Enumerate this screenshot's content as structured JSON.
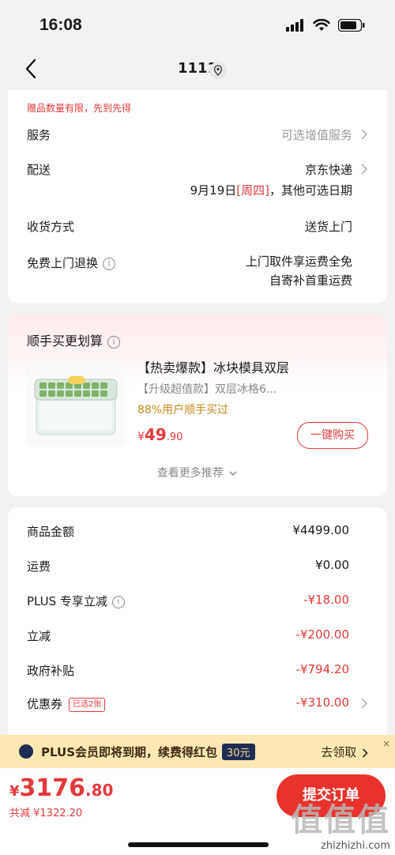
{
  "status": {
    "time": "16:08"
  },
  "nav": {
    "title": "1111"
  },
  "card1": {
    "gift_note": "赠品数量有限，先到先得",
    "service_label": "服务",
    "service_value": "可选增值服务",
    "delivery_label": "配送",
    "delivery_value": "京东快递",
    "delivery_date_prefix": "9月19日",
    "delivery_date_weekday": "[周四]",
    "delivery_date_suffix": "，其他可选日期",
    "receive_label": "收货方式",
    "receive_value": "送货上门",
    "return_label": "免费上门退换",
    "return_line1": "上门取件享运费全免",
    "return_line2": "自寄补首重运费"
  },
  "recommend": {
    "title": "顺手买更划算",
    "product_title": "【热卖爆款】冰块模具双层",
    "product_sub": "【升级超值款】双层冰格6...",
    "product_note": "88%用户顺手买过",
    "price_symbol": "¥",
    "price_int": "49",
    "price_dec": ".90",
    "buy_label": "一键购买",
    "more_label": "查看更多推荐"
  },
  "amounts": {
    "rows": [
      {
        "label": "商品金额",
        "value": "¥4499.00"
      },
      {
        "label": "运费",
        "value": "¥0.00"
      },
      {
        "label": "PLUS 专享立减",
        "value": "-¥18.00"
      },
      {
        "label": "立减",
        "value": "-¥200.00"
      },
      {
        "label": "政府补贴",
        "value": "-¥794.20"
      },
      {
        "label": "优惠券",
        "value": "-¥310.00"
      }
    ],
    "coupon_badge": "已选2张"
  },
  "plus": {
    "text": "PLUS会员即将到期，续费得红包",
    "amount": "30元",
    "action": "去领取",
    "close": "×"
  },
  "bottom": {
    "symbol": "¥",
    "total_int": "3176",
    "total_dec": ".80",
    "saved": "共减 ¥1322.20",
    "submit": "提交订单"
  },
  "watermark": {
    "big": "值值值",
    "small": "zhizhizhi.com"
  },
  "colors": {
    "accent": "#e4393c",
    "plus_bg": "#fbe8b2"
  }
}
